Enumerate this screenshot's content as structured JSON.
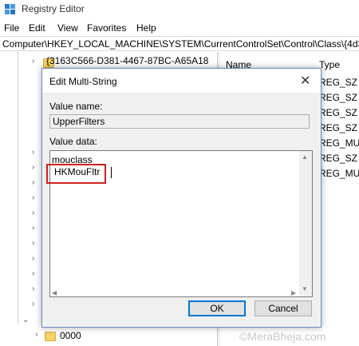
{
  "window": {
    "title": "Registry Editor"
  },
  "menu": [
    "File",
    "Edit",
    "View",
    "Favorites",
    "Help"
  ],
  "address": "Computer\\HKEY_LOCAL_MACHINE\\SYSTEM\\CurrentControlSet\\Control\\Class\\{4d36",
  "tree": {
    "selected_key": "{3163C566-D381-4467-87BC-A65A18",
    "child_key": "0000"
  },
  "list": {
    "columns": {
      "name": "Name",
      "type": "Type"
    },
    "types": [
      "REG_SZ",
      "REG_SZ",
      "REG_SZ",
      "REG_SZ",
      "REG_MUL",
      "REG_SZ",
      "REG_MUL"
    ]
  },
  "dialog": {
    "title": "Edit Multi-String",
    "close_glyph": "✕",
    "value_name_label": "Value name:",
    "value_name": "UpperFilters",
    "value_data_label": "Value data:",
    "value_data": [
      "mouclass",
      "HKMouFltr"
    ],
    "ok_label": "OK",
    "cancel_label": "Cancel"
  },
  "watermark": "©MeraBheja.com"
}
